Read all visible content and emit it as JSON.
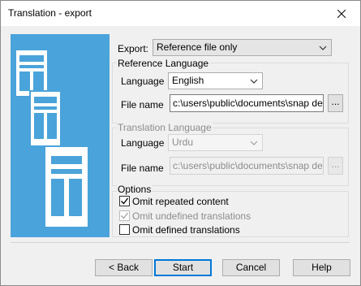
{
  "window": {
    "title": "Translation - export"
  },
  "export": {
    "label": "Export:",
    "value": "Reference file only"
  },
  "reference": {
    "group_title": "Reference Language",
    "language_label": "Language",
    "language_value": "English",
    "file_label": "File name",
    "file_value": "c:\\users\\public\\documents\\snap deskt",
    "browse_label": "..."
  },
  "translation": {
    "group_title": "Translation Language",
    "language_label": "Language",
    "language_value": "Urdu",
    "file_label": "File name",
    "file_value": "c:\\users\\public\\documents\\snap deskt",
    "browse_label": "..."
  },
  "options": {
    "group_title": "Options",
    "items": [
      {
        "label": "Omit repeated content",
        "checked": true,
        "enabled": true
      },
      {
        "label": "Omit undefined translations",
        "checked": true,
        "enabled": false
      },
      {
        "label": "Omit defined translations",
        "checked": false,
        "enabled": true
      }
    ]
  },
  "buttons": {
    "back": "< Back",
    "start": "Start",
    "cancel": "Cancel",
    "help": "Help"
  }
}
